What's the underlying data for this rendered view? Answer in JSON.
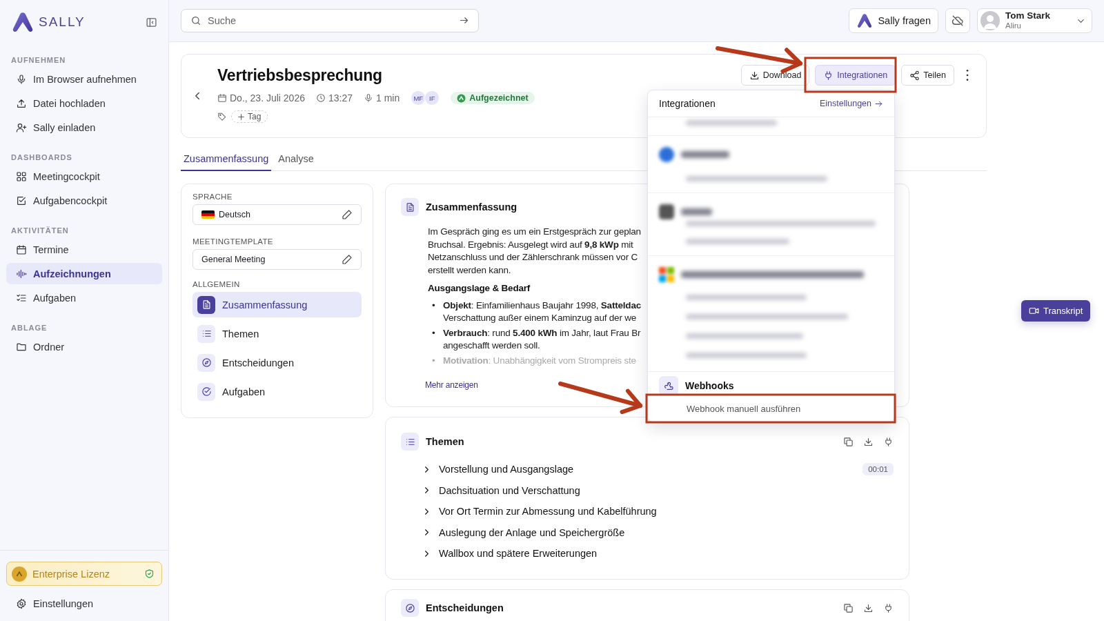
{
  "brand": {
    "name": "SALLY"
  },
  "sidebar": {
    "sections": [
      {
        "heading": "AUFNEHMEN",
        "items": [
          {
            "label": "Im Browser aufnehmen",
            "selected": false
          },
          {
            "label": "Datei hochladen",
            "selected": false
          },
          {
            "label": "Sally einladen",
            "selected": false
          }
        ]
      },
      {
        "heading": "DASHBOARDS",
        "items": [
          {
            "label": "Meetingcockpit",
            "selected": false
          },
          {
            "label": "Aufgabencockpit",
            "selected": false
          }
        ]
      },
      {
        "heading": "AKTIVITÄTEN",
        "items": [
          {
            "label": "Termine",
            "selected": false
          },
          {
            "label": "Aufzeichnungen",
            "selected": true
          },
          {
            "label": "Aufgaben",
            "selected": false
          }
        ]
      },
      {
        "heading": "ABLAGE",
        "items": [
          {
            "label": "Ordner",
            "selected": false
          }
        ]
      }
    ],
    "license": "Enterprise Lizenz",
    "settings": "Einstellungen"
  },
  "header": {
    "search": {
      "placeholder": "Suche"
    },
    "ask_button": "Sally fragen",
    "user": {
      "name": "Tom Stark",
      "org": "Aliru"
    }
  },
  "meeting": {
    "title": "Vertriebsbesprechung",
    "date": "Do., 23. Juli 2026",
    "time": "13:27",
    "duration": "1 min",
    "participants": [
      "MF",
      "IF"
    ],
    "status": "Aufgezeichnet",
    "tag_button": "Tag",
    "actions": [
      {
        "label": "Download",
        "selected": false
      },
      {
        "label": "Integrationen",
        "selected": true
      },
      {
        "label": "Teilen",
        "selected": false
      }
    ]
  },
  "tabs": [
    {
      "label": "Zusammenfassung",
      "selected": true
    },
    {
      "label": "Analyse",
      "selected": false
    }
  ],
  "settings_panel": {
    "fields": [
      {
        "label": "SPRACHE",
        "value": "Deutsch",
        "kind": "language"
      },
      {
        "label": "MEETINGTEMPLATE",
        "value": "General Meeting",
        "kind": "text"
      }
    ],
    "section": "ALLGEMEIN",
    "nav": [
      {
        "label": "Zusammenfassung",
        "selected": true
      },
      {
        "label": "Themen",
        "selected": false
      },
      {
        "label": "Entscheidungen",
        "selected": false
      },
      {
        "label": "Aufgaben",
        "selected": false
      }
    ]
  },
  "summary_card": {
    "title": "Zusammenfassung",
    "lines": [
      "Im Gespräch ging es um ein Erstgespräch zur geplan",
      "Bruchsal. Ergebnis: Ausgelegt wird auf **9,8 kWp** mit",
      "Netzanschluss und der Zählerschrank müssen vor C",
      "erstellt werden kann."
    ],
    "subheading": "Ausgangslage & Bedarf",
    "bullets": [
      {
        "marker": "•",
        "lines": [
          "**Objekt**: Einfamilienhaus Baujahr 1998, **Satteldac**",
          "Verschattung außer einem Kaminzug auf der we"
        ],
        "faded": false
      },
      {
        "marker": "•",
        "lines": [
          "**Verbrauch**: rund **5.400 kWh** im Jahr, laut Frau Br",
          "angeschafft werden soll."
        ],
        "faded": false
      },
      {
        "marker": "•",
        "lines": [
          "**Motivation**: Unabhängigkeit vom Strompreis ste"
        ],
        "faded": true
      }
    ],
    "more_link": "Mehr anzeigen"
  },
  "integrations_menu": {
    "title": "Integrationen",
    "settings_link": "Einstellungen",
    "webhooks": {
      "title": "Webhooks",
      "items": [
        {
          "label": "Webhook manuell ausführen"
        }
      ]
    }
  },
  "topics_card": {
    "title": "Themen",
    "items": [
      {
        "label": "Vorstellung und Ausgangslage",
        "time": "00:01"
      },
      {
        "label": "Dachsituation und Verschattung"
      },
      {
        "label": "Vor Ort Termin zur Abmessung und Kabelführung"
      },
      {
        "label": "Auslegung der Anlage und Speichergröße"
      },
      {
        "label": "Wallbox und spätere Erweiterungen"
      }
    ]
  },
  "decisions_card": {
    "title": "Entscheidungen"
  },
  "transcript_button": "Transkript",
  "annotations": [
    {
      "kind": "arrow"
    },
    {
      "kind": "box"
    },
    {
      "kind": "arrow"
    },
    {
      "kind": "box"
    }
  ]
}
